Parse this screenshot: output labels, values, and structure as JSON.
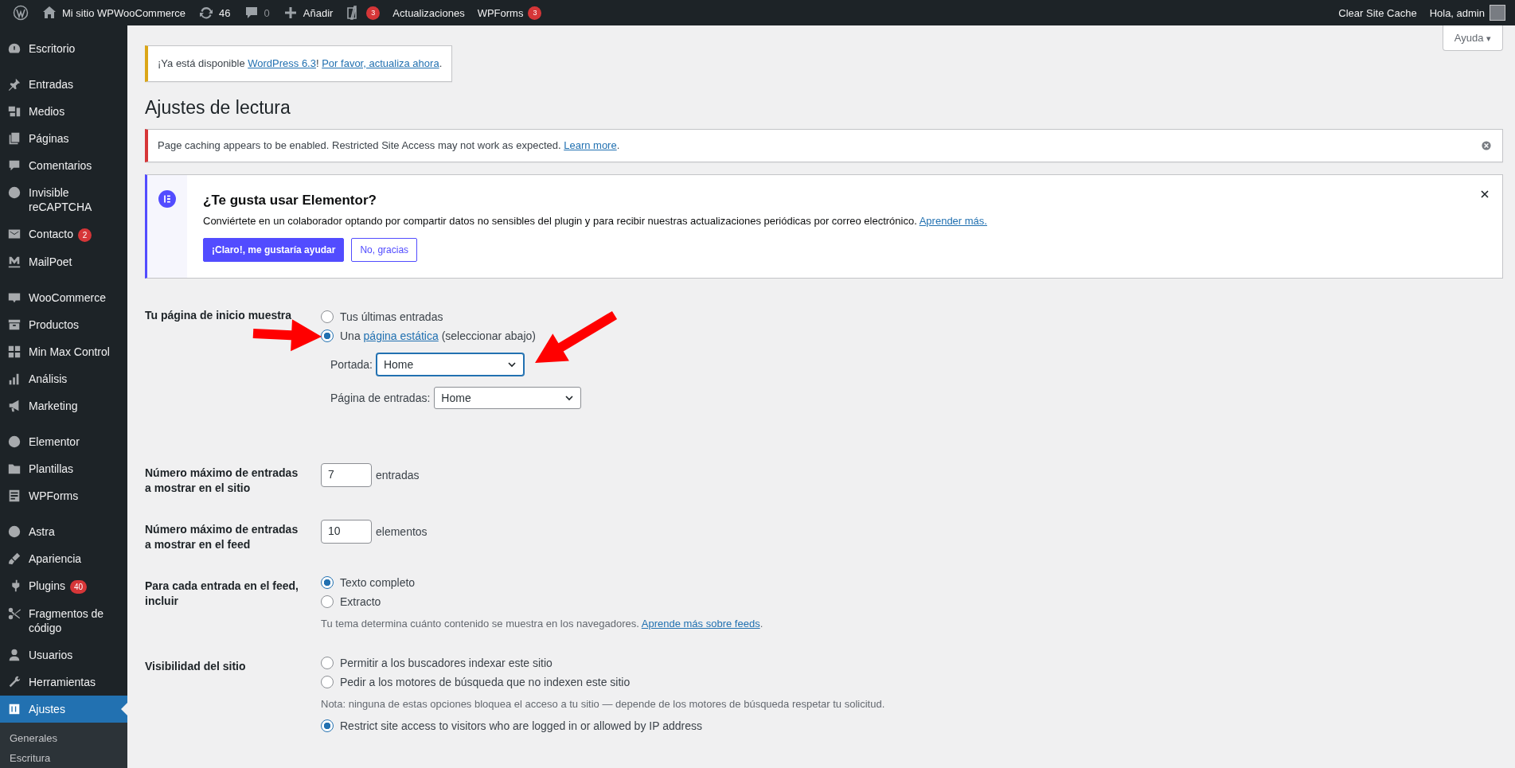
{
  "admin_bar": {
    "left": [
      {
        "kind": "logo"
      },
      {
        "kind": "site",
        "text": "Mi sitio WPWooCommerce"
      },
      {
        "kind": "updates",
        "text": "46"
      },
      {
        "kind": "comments",
        "text": "0"
      },
      {
        "kind": "new",
        "text": "Añadir"
      },
      {
        "kind": "seo",
        "badge": "3"
      },
      {
        "kind": "text",
        "text": "Actualizaciones"
      },
      {
        "kind": "text",
        "text": "WPForms",
        "badge": "3"
      }
    ],
    "right": [
      {
        "kind": "text",
        "text": "Clear Site Cache"
      },
      {
        "kind": "account",
        "text": "Hola, admin"
      }
    ]
  },
  "sidebar": {
    "groups": [
      [
        {
          "label": "Escritorio",
          "selected": false
        }
      ],
      [
        {
          "label": "Entradas",
          "selected": false
        },
        {
          "label": "Medios",
          "selected": false
        },
        {
          "label": "Páginas",
          "selected": false
        },
        {
          "label": "Comentarios",
          "selected": false
        },
        {
          "label": "Invisible reCAPTCHA",
          "selected": false
        },
        {
          "label": "Contacto",
          "badge": "2",
          "selected": false
        },
        {
          "label": "MailPoet",
          "selected": false
        }
      ],
      [
        {
          "label": "WooCommerce",
          "selected": false
        },
        {
          "label": "Productos",
          "selected": false
        },
        {
          "label": "Min Max Control",
          "selected": false
        },
        {
          "label": "Análisis",
          "selected": false
        },
        {
          "label": "Marketing",
          "selected": false
        }
      ],
      [
        {
          "label": "Elementor",
          "selected": false
        },
        {
          "label": "Plantillas",
          "selected": false
        },
        {
          "label": "WPForms",
          "selected": false
        }
      ],
      [
        {
          "label": "Astra",
          "selected": false
        },
        {
          "label": "Apariencia",
          "selected": false
        },
        {
          "label": "Plugins",
          "badge": "40",
          "selected": false
        },
        {
          "label": "Fragmentos de código",
          "selected": false
        },
        {
          "label": "Usuarios",
          "selected": false
        },
        {
          "label": "Herramientas",
          "selected": false
        },
        {
          "label": "Ajustes",
          "selected": true,
          "children": [
            {
              "label": "Generales"
            },
            {
              "label": "Escritura"
            }
          ]
        }
      ]
    ]
  },
  "help_button": "Ayuda",
  "help_caret": "▾",
  "update_notice": {
    "text": "¡Ya está disponible",
    "link1": "WordPress 6.3",
    "sep": "!",
    "link2": "Por favor, actualiza ahora",
    "end": "."
  },
  "page_title": "Ajustes de lectura",
  "cache_notice": {
    "text": "Page caching appears to be enabled. Restricted Site Access may not work as expected.",
    "link": "Learn more",
    "end": "."
  },
  "elementor_notice": {
    "title": "¿Te gusta usar Elementor?",
    "text": "Conviértete en un colaborador optando por compartir datos no sensibles del plugin y para recibir nuestras actualizaciones periódicas por correo electrónico.",
    "link": "Aprender más.",
    "primary_button": "¡Claro!, me gustaría ayudar",
    "secondary_button": "No, gracias"
  },
  "settings": [
    {
      "label": "Tu página de inicio muestra",
      "items": [
        {
          "kind": "radio",
          "label": "Tus últimas entradas",
          "selected": false
        },
        {
          "kind": "radio",
          "label": "Una",
          "link": "página estática",
          "suffix": "(seleccionar abajo)",
          "selected": true
        },
        {
          "kind": "select",
          "label": "Portada:",
          "value": "Home",
          "focused": true
        },
        {
          "kind": "select",
          "label": "Página de entradas:",
          "value": "Home",
          "focused": false
        }
      ]
    },
    {
      "label": "Número máximo de entradas a mostrar en el sitio",
      "items": [
        {
          "kind": "number",
          "value": "7",
          "unit": "entradas"
        }
      ]
    },
    {
      "label": "Número máximo de entradas a mostrar en el feed",
      "items": [
        {
          "kind": "number",
          "value": "10",
          "unit": "elementos"
        }
      ]
    },
    {
      "label": "Para cada entrada en el feed, incluir",
      "items": [
        {
          "kind": "radio",
          "label": "Texto completo",
          "selected": true
        },
        {
          "kind": "radio",
          "label": "Extracto",
          "selected": false
        },
        {
          "kind": "note",
          "label": "Tu tema determina cuánto contenido se muestra en los navegadores.",
          "link": "Aprende más sobre feeds",
          "suffix": "."
        }
      ]
    },
    {
      "label": "Visibilidad del sitio",
      "items": [
        {
          "kind": "radio",
          "label": "Permitir a los buscadores indexar este sitio",
          "selected": false
        },
        {
          "kind": "radio",
          "label": "Pedir a los motores de búsqueda que no indexen este sitio",
          "selected": false
        },
        {
          "kind": "note",
          "label": "Nota: ninguna de estas opciones bloquea el acceso a tu sitio — depende de los motores de búsqueda respetar tu solicitud."
        },
        {
          "kind": "radio",
          "label": "Restrict site access to visitors who are logged in or allowed by IP address",
          "selected": true
        }
      ]
    }
  ]
}
